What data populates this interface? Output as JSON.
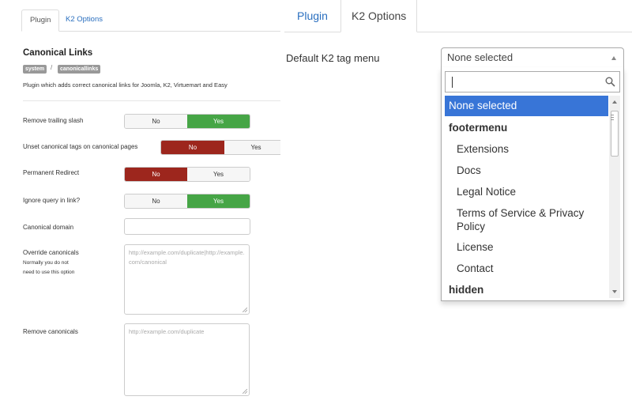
{
  "left_panel": {
    "tabs": [
      {
        "label": "Plugin",
        "active": true
      },
      {
        "label": "K2 Options",
        "active": false
      }
    ],
    "plugin_title": "Canonical Links",
    "badges": [
      "system",
      "canonicallinks"
    ],
    "badge_separator": "/",
    "description": "Plugin which adds correct canonical links for Joomla, K2, Virtuemart and Easy",
    "fields": {
      "remove_trailing_slash": {
        "label": "Remove trailing slash",
        "options": [
          "No",
          "Yes"
        ],
        "selected": "Yes"
      },
      "unset_canonical": {
        "label": "Unset canonical tags on canonical pages",
        "options": [
          "No",
          "Yes"
        ],
        "selected": "No"
      },
      "permanent_redirect": {
        "label": "Permanent Redirect",
        "options": [
          "No",
          "Yes"
        ],
        "selected": "No"
      },
      "ignore_query": {
        "label": "Ignore query in link?",
        "options": [
          "No",
          "Yes"
        ],
        "selected": "Yes"
      },
      "canonical_domain": {
        "label": "Canonical domain",
        "value": ""
      },
      "override_canonicals": {
        "label": "Override canonicals",
        "sub_label_1": "Normally you do not",
        "sub_label_2": "need to use this option",
        "placeholder": "http://example.com/duplicate|http://example.com/canonical"
      },
      "remove_canonicals": {
        "label": "Remove canonicals",
        "placeholder": "http://example.com/duplicate"
      }
    }
  },
  "right_panel": {
    "tabs": [
      {
        "label": "Plugin",
        "active": false
      },
      {
        "label": "K2 Options",
        "active": true
      }
    ],
    "field_label": "Default K2 tag menu",
    "select_value": "None selected",
    "search_value": "",
    "search_icon": "magnifier-icon",
    "options": [
      {
        "label": "None selected",
        "type": "selected"
      },
      {
        "label": "footermenu",
        "type": "group"
      },
      {
        "label": "Extensions",
        "type": "child"
      },
      {
        "label": "Docs",
        "type": "child"
      },
      {
        "label": "Legal Notice",
        "type": "child"
      },
      {
        "label": "Terms of Service & Privacy Policy",
        "type": "child"
      },
      {
        "label": "License",
        "type": "child"
      },
      {
        "label": "Contact",
        "type": "child"
      },
      {
        "label": "hidden",
        "type": "group"
      }
    ]
  },
  "colors": {
    "link": "#2a6fbf",
    "yes_green": "#46a546",
    "no_red": "#9d261d",
    "selected_blue": "#3875d7"
  }
}
